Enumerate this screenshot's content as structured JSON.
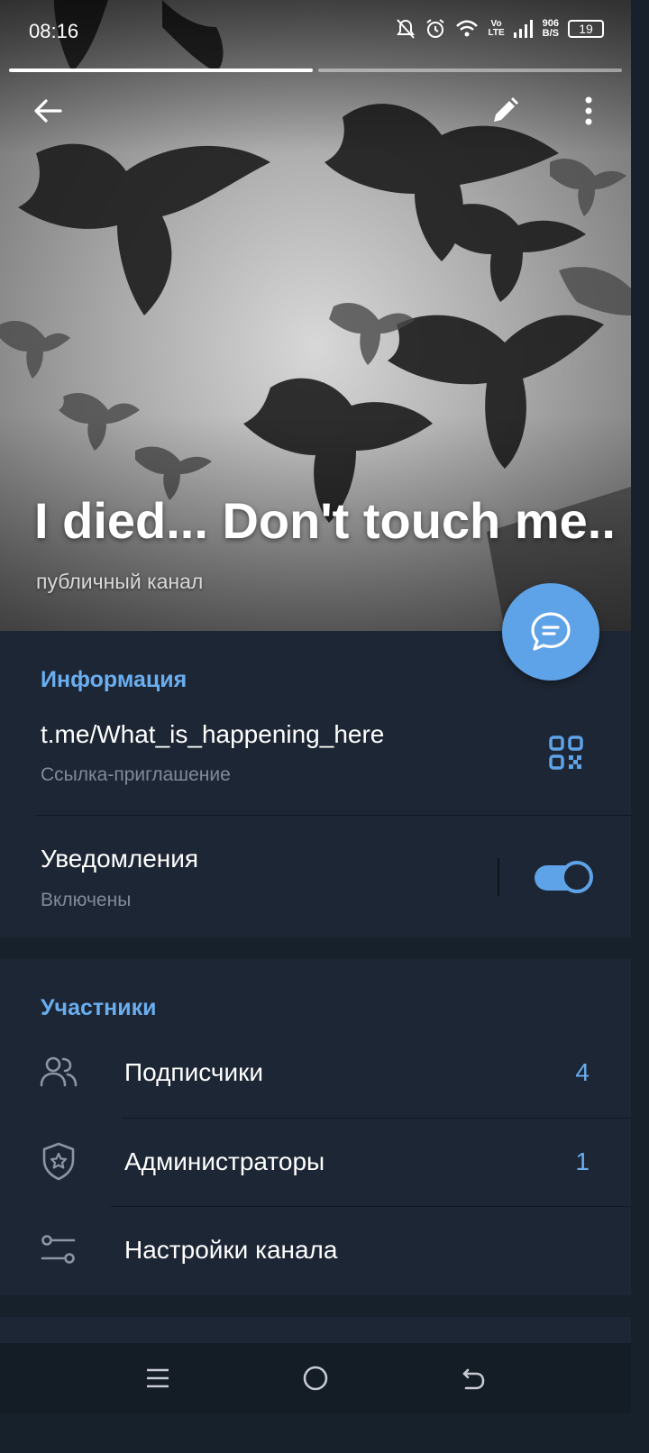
{
  "status_bar": {
    "time": "08:16",
    "net_speed": "906",
    "net_speed_unit": "B/S",
    "volte": "Vo",
    "lte": "LTE",
    "battery": "19"
  },
  "story_progress": [
    1.0,
    0.0
  ],
  "header_icons": [
    "back-arrow-icon",
    "edit-pencil-icon",
    "more-vert-icon"
  ],
  "channel": {
    "name": "I died... Don't touch me..",
    "type_label": "публичный канал"
  },
  "info": {
    "section_title": "Информация",
    "link": "t.me/What_is_happening_here",
    "link_caption": "Ссылка-приглашение",
    "notifications_label": "Уведомления",
    "notifications_state": "Включены",
    "notifications_enabled": true
  },
  "members": {
    "section_title": "Участники",
    "items": [
      {
        "label": "Подписчики",
        "count": "4",
        "icon": "people-icon"
      },
      {
        "label": "Администраторы",
        "count": "1",
        "icon": "admin-shield-icon"
      },
      {
        "label": "Настройки канала",
        "count": "",
        "icon": "settings-sliders-icon"
      }
    ]
  },
  "nav_bar": [
    "menu-icon",
    "home-circle-icon",
    "back-icon"
  ],
  "colors": {
    "accent": "#5ea2e8",
    "section_bg": "#1d2634",
    "page_bg": "#17212b",
    "secondary_text": "#818b98"
  }
}
